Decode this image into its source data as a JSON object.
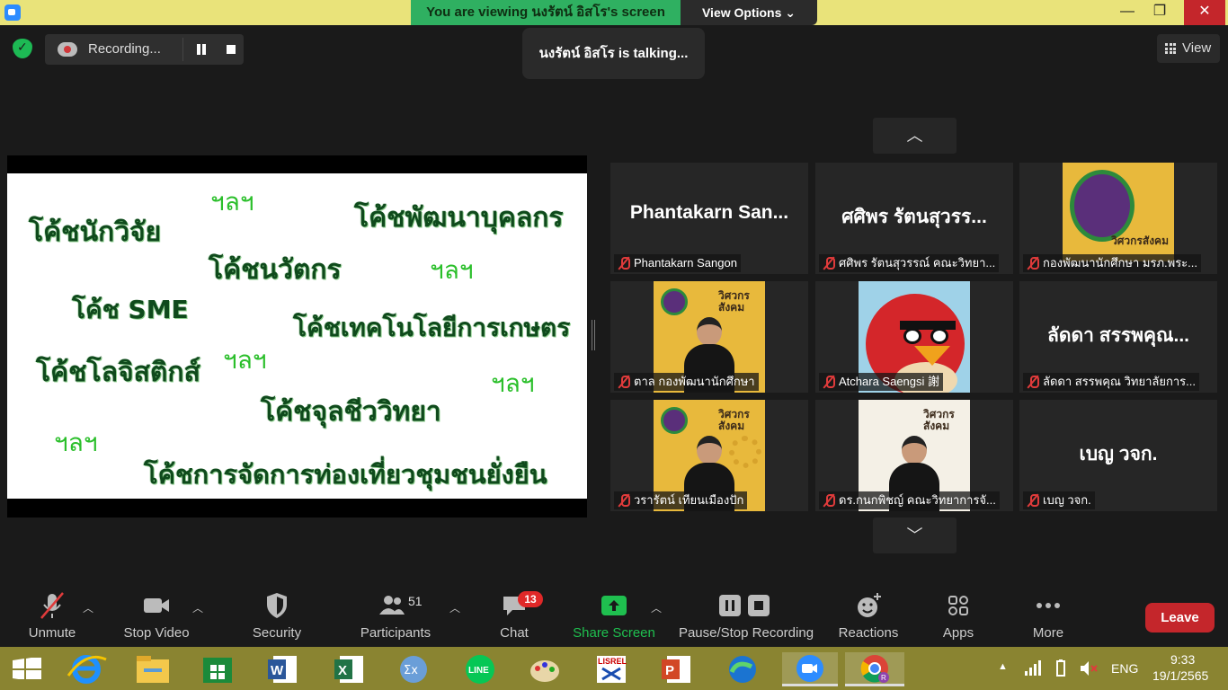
{
  "banner": {
    "viewing_text": "You are viewing นงรัตน์ อิสโร's screen",
    "view_options": "View Options ⌄"
  },
  "recording": {
    "label": "Recording..."
  },
  "talking": "นงรัตน์ อิสโร is talking...",
  "view_button": "View",
  "slide": {
    "words": [
      "โค้ชนักวิจัย",
      "โค้ชพัฒนาบุคลกร",
      "โค้ชนวัตกร",
      "โค้ช SME",
      "โค้ชเทคโนโลยีการเกษตร",
      "โค้ชโลจิสติกส์",
      "โค้ชจุลชีววิทยา",
      "โค้ชการจัดการท่องเที่ยวชุมชนยั่งยืน"
    ],
    "lala": "ฯลฯ"
  },
  "gallery": {
    "tiles": [
      {
        "big": "Phantakarn San...",
        "name": "Phantakarn Sangon"
      },
      {
        "big": "ศศิพร รัตนสุวรร...",
        "name": "ศศิพร รัตนสุวรรณ์ คณะวิทยา..."
      },
      {
        "big": "",
        "name": "กองพัฒนานักศึกษา มรภ.พระ..."
      },
      {
        "big": "",
        "name": "ตาล กองพัฒนานักศึกษา"
      },
      {
        "big": "",
        "name": "Atchara Saengsi 謝"
      },
      {
        "big": "ลัดดา สรรพคุณ...",
        "name": "ลัดดา สรรพคุณ วิทยาลัยการ..."
      },
      {
        "big": "",
        "name": "วรารัตน์ เทียนเมืองปัก"
      },
      {
        "big": "",
        "name": "ดร.กนกพิชญ์ คณะวิทยาการจั..."
      },
      {
        "big": "เบญ วจก.",
        "name": "เบญ วจก."
      }
    ],
    "logo_text": "วิศวกรสังคม"
  },
  "toolbar": {
    "unmute": "Unmute",
    "stop_video": "Stop Video",
    "security": "Security",
    "participants": "Participants",
    "participants_count": "51",
    "chat": "Chat",
    "chat_badge": "13",
    "share_screen": "Share Screen",
    "pause_stop_recording": "Pause/Stop Recording",
    "reactions": "Reactions",
    "apps": "Apps",
    "more": "More",
    "leave": "Leave"
  },
  "taskbar": {
    "lang": "ENG",
    "time": "9:33",
    "date": "19/1/2565",
    "lisrel_label": "LISREL"
  },
  "colors": {
    "banner_yellow": "#e9e37a",
    "banner_green": "#2fb061",
    "leave_red": "#c4262b",
    "share_green": "#1fbf4f",
    "taskbar": "#8a8431"
  }
}
